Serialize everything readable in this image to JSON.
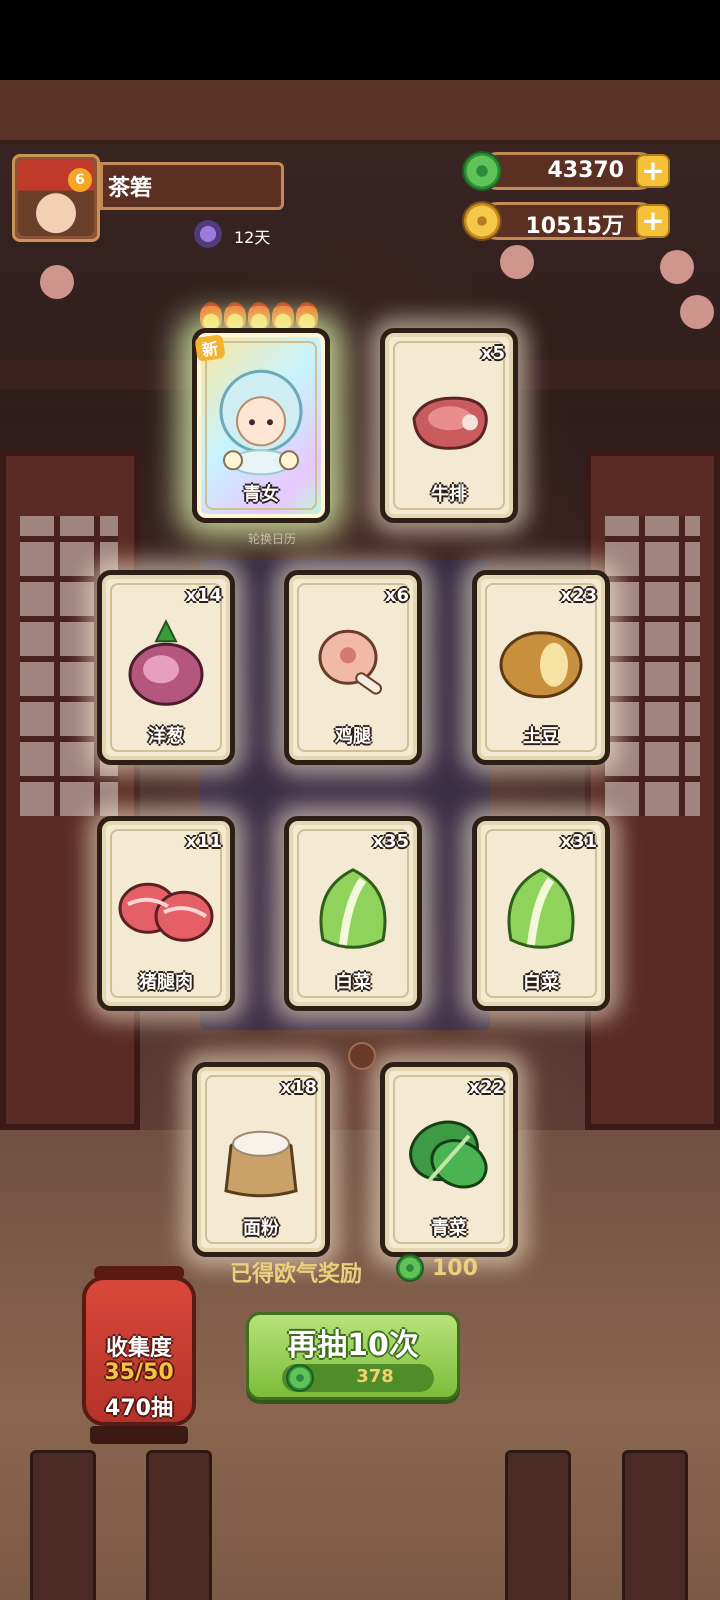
{
  "player": {
    "name": "茶箬",
    "days": "12天"
  },
  "currency": {
    "jade": "43370",
    "coins": "10515万"
  },
  "icons": {
    "avatar_badge": "6",
    "plus": "+",
    "new_tag": "新"
  },
  "featured": {
    "calendar_label": "轮换日历"
  },
  "cards": [
    {
      "label": "青女",
      "qty": "",
      "icon": "character-qingnv-icon",
      "special": true,
      "new": true
    },
    {
      "label": "牛排",
      "qty": "x5",
      "icon": "steak-icon"
    },
    {
      "label": "洋葱",
      "qty": "x14",
      "icon": "onion-icon"
    },
    {
      "label": "鸡腿",
      "qty": "x6",
      "icon": "chicken-leg-icon"
    },
    {
      "label": "土豆",
      "qty": "x23",
      "icon": "potato-icon"
    },
    {
      "label": "猪腿肉",
      "qty": "x11",
      "icon": "pork-icon"
    },
    {
      "label": "白菜",
      "qty": "x35",
      "icon": "cabbage-icon"
    },
    {
      "label": "白菜",
      "qty": "x31",
      "icon": "cabbage-icon"
    },
    {
      "label": "面粉",
      "qty": "x18",
      "icon": "flour-icon"
    },
    {
      "label": "青菜",
      "qty": "x22",
      "icon": "greens-icon"
    }
  ],
  "reward": {
    "text": "已得欧气奖励",
    "value": "100"
  },
  "draw_button": {
    "label": "再抽10次",
    "cost": "378"
  },
  "collection": {
    "title": "收集度",
    "progress": "35/50",
    "draws": "470抽"
  },
  "colors": {
    "jade": "#5fc35a",
    "coin": "#f6c84a",
    "button": "#8cc84b",
    "lantern": "#d0413a"
  }
}
